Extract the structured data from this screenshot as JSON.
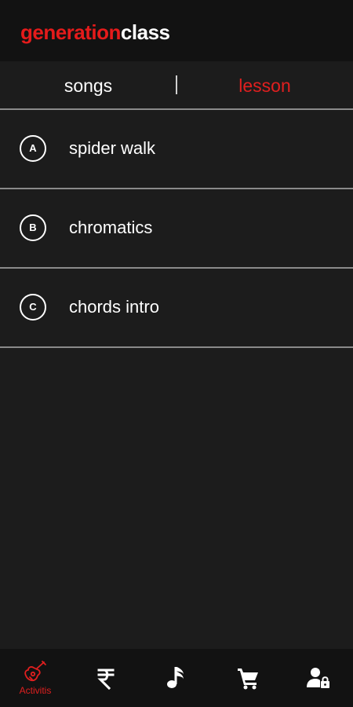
{
  "app": {
    "logo_part1": "generation",
    "logo_part2": "class"
  },
  "tabs": {
    "songs": "songs",
    "lesson": "lesson",
    "active": "lesson"
  },
  "lessons": [
    {
      "badge": "A",
      "title": "spider walk"
    },
    {
      "badge": "B",
      "title": "chromatics"
    },
    {
      "badge": "C",
      "title": "chords intro"
    }
  ],
  "bottom_nav": {
    "items": [
      {
        "icon": "guitar-icon",
        "label": "Activitis",
        "active": true
      },
      {
        "icon": "rupee-icon",
        "label": ""
      },
      {
        "icon": "music-note-icon",
        "label": ""
      },
      {
        "icon": "cart-icon",
        "label": ""
      },
      {
        "icon": "user-lock-icon",
        "label": ""
      }
    ]
  },
  "colors": {
    "accent": "#e01f1f",
    "background": "#1c1c1c",
    "bar": "#121212",
    "text": "#ffffff",
    "divider": "#8a8a8a"
  }
}
